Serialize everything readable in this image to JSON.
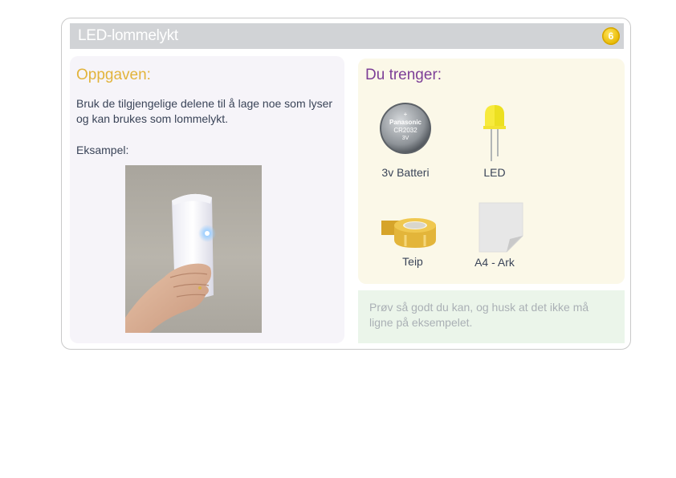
{
  "card": {
    "title": "LED-lommelykt",
    "badge_number": "6"
  },
  "task": {
    "heading": "Oppgaven:",
    "description": "Bruk de tilgjengelige delene til å lage noe som lyser og kan brukes som lommelykt.",
    "example_label": "Eksampel:"
  },
  "needs": {
    "heading": "Du trenger:",
    "items": [
      {
        "label": "3v Batteri",
        "icon": "coin-battery-icon",
        "engraving": [
          "Panasonic",
          "CR2032",
          "3V"
        ]
      },
      {
        "label": "LED",
        "icon": "led-icon"
      },
      {
        "label": "Teip",
        "icon": "tape-roll-icon"
      },
      {
        "label": "A4 - Ark",
        "icon": "paper-sheet-icon"
      }
    ]
  },
  "tip": {
    "text": "Prøv så godt du kan, og husk at det ikke må ligne på eksempelet."
  },
  "colors": {
    "title_bar": "#d1d3d6",
    "task_heading": "#e2b43c",
    "needs_heading": "#7d3f97",
    "task_panel": "#f6f4f9",
    "needs_panel": "#fbf8e8",
    "tip_panel": "#ebf5ea",
    "tip_text": "#aab0b5",
    "body_text": "#3a4458",
    "badge": "#f5c800"
  }
}
